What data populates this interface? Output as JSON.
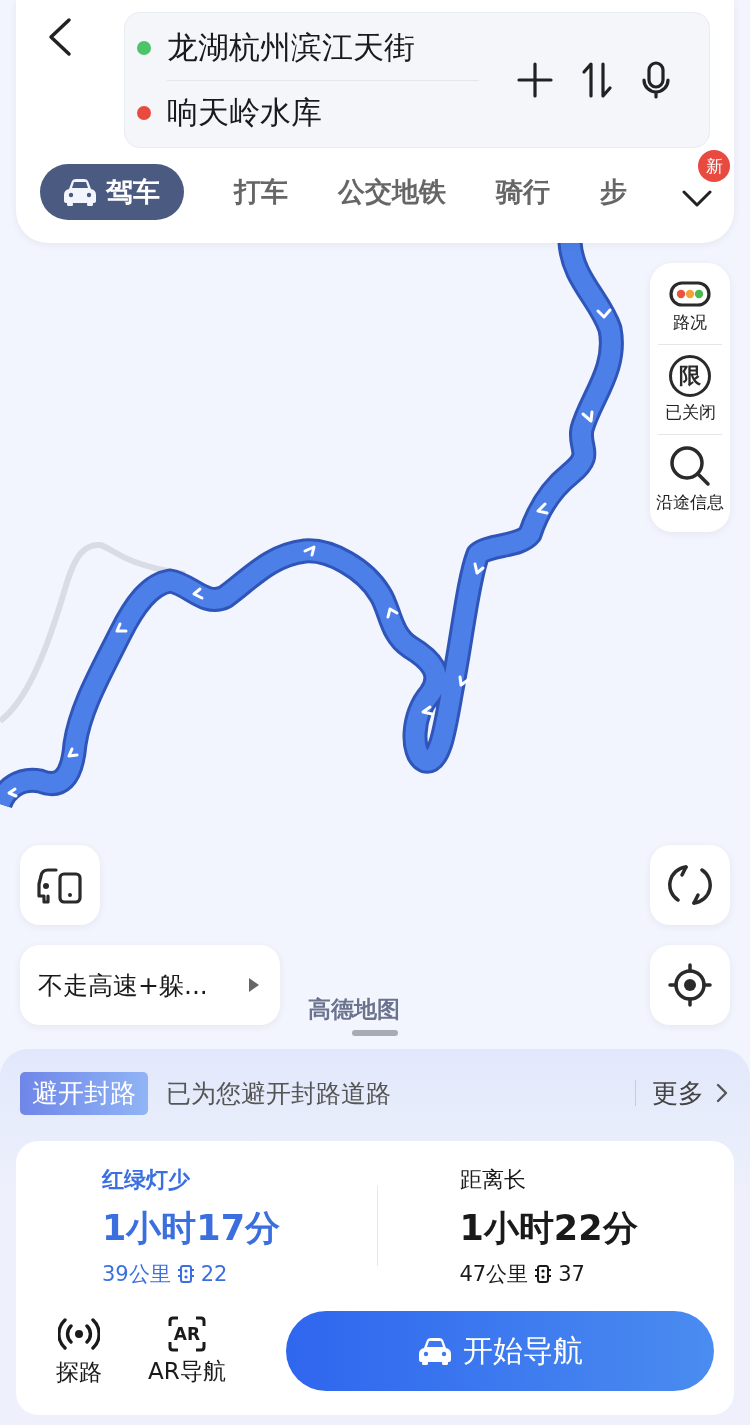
{
  "header": {
    "origin": {
      "text": "龙湖杭州滨江天街",
      "color": "#4cc46a"
    },
    "destination": {
      "text": "响天岭水库",
      "color": "#e84a3f"
    }
  },
  "modes": [
    {
      "label": "驾车",
      "selected": true
    },
    {
      "label": "打车",
      "selected": false
    },
    {
      "label": "公交地铁",
      "selected": false
    },
    {
      "label": "骑行",
      "selected": false
    },
    {
      "label": "步",
      "selected": false
    }
  ],
  "new_badge": "新",
  "map_tools": {
    "traffic": "路况",
    "restriction": {
      "icon_text": "限",
      "label": "已关闭"
    },
    "along": "沿途信息"
  },
  "preference": "不走高速+躲...",
  "map_logo": "高德地图",
  "notice": {
    "tag": "避开封路",
    "text": "已为您避开封路道路",
    "more": "更多"
  },
  "routes": [
    {
      "label": "红绿灯少",
      "duration": "1小时17分",
      "distance": "39公里",
      "lights": "22",
      "selected": true
    },
    {
      "label": "距离长",
      "duration": "1小时22分",
      "distance": "47公里",
      "lights": "37",
      "selected": false
    }
  ],
  "actions": [
    {
      "kind": "probe",
      "label": "探路"
    },
    {
      "kind": "ar",
      "icon_text": "AR",
      "label": "AR导航"
    }
  ],
  "start_button": "开始导航"
}
